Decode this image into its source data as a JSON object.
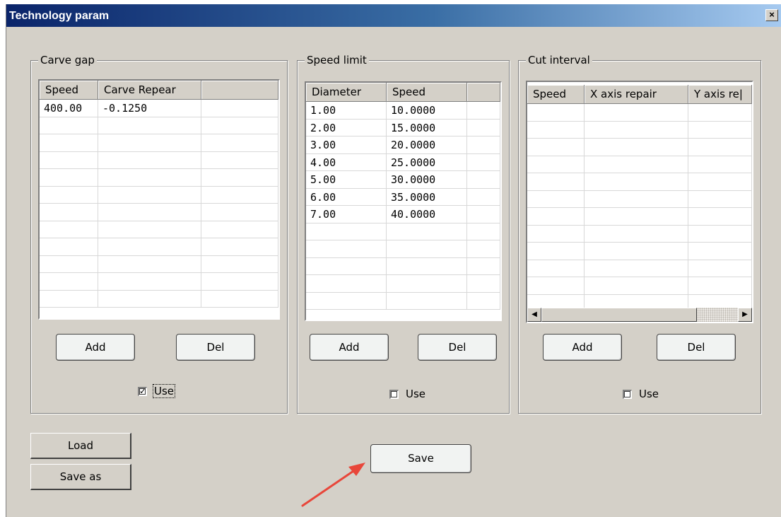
{
  "window": {
    "title": "Technology param",
    "close_glyph": "×"
  },
  "carve_gap": {
    "legend": "Carve gap",
    "columns": [
      "Speed",
      "Carve Repear",
      ""
    ],
    "rows": [
      [
        "400.00",
        "-0.1250",
        ""
      ]
    ],
    "add_label": "Add",
    "del_label": "Del",
    "use_label": "Use",
    "use_checked": true
  },
  "speed_limit": {
    "legend": "Speed limit",
    "columns": [
      "Diameter",
      "Speed",
      ""
    ],
    "rows": [
      [
        "1.00",
        "10.0000",
        ""
      ],
      [
        "2.00",
        "15.0000",
        ""
      ],
      [
        "3.00",
        "20.0000",
        ""
      ],
      [
        "4.00",
        "25.0000",
        ""
      ],
      [
        "5.00",
        "30.0000",
        ""
      ],
      [
        "6.00",
        "35.0000",
        ""
      ],
      [
        "7.00",
        "40.0000",
        ""
      ]
    ],
    "add_label": "Add",
    "del_label": "Del",
    "use_label": "Use",
    "use_checked": false
  },
  "cut_interval": {
    "legend": "Cut interval",
    "columns": [
      "Speed",
      "X axis repair",
      "Y axis re|"
    ],
    "rows": [],
    "add_label": "Add",
    "del_label": "Del",
    "use_label": "Use",
    "use_checked": false,
    "scroll_left_glyph": "◀",
    "scroll_right_glyph": "▶"
  },
  "actions": {
    "load_label": "Load",
    "save_as_label": "Save as",
    "save_label": "Save"
  },
  "annotation": {
    "arrow_color": "#e8463a"
  },
  "colors": {
    "dialog_bg": "#d4d0c8",
    "title_start": "#0a246a",
    "title_end": "#a6caf0"
  }
}
